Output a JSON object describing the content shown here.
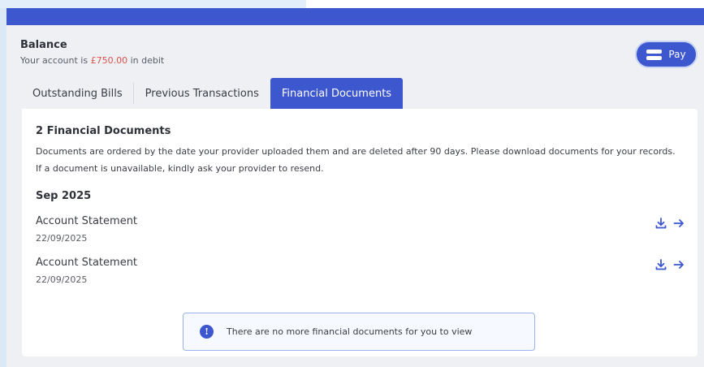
{
  "balance": {
    "title": "Balance",
    "prefix": "Your account is",
    "amount": "£750.00",
    "suffix": "in debit",
    "amount_color": "#d9534f"
  },
  "pay_button": {
    "label": "Pay",
    "icon": "credit-card-icon"
  },
  "tabs": [
    {
      "label": "Outstanding Bills",
      "active": false
    },
    {
      "label": "Previous Transactions",
      "active": false
    },
    {
      "label": "Financial Documents",
      "active": true
    }
  ],
  "documents": {
    "heading": "2 Financial Documents",
    "description": "Documents are ordered by the date your provider uploaded them and are deleted after 90 days. Please download documents for your records. If a document is unavailable, kindly ask your provider to resend.",
    "groups": [
      {
        "month": "Sep 2025",
        "items": [
          {
            "title": "Account Statement",
            "date": "22/09/2025"
          },
          {
            "title": "Account Statement",
            "date": "22/09/2025"
          }
        ]
      }
    ]
  },
  "notice": {
    "text": "There are no more financial documents for you to view",
    "icon": "info-icon"
  },
  "colors": {
    "accent": "#3d57cf",
    "panel": "#eef0f4",
    "background": "#dbe9f7"
  }
}
